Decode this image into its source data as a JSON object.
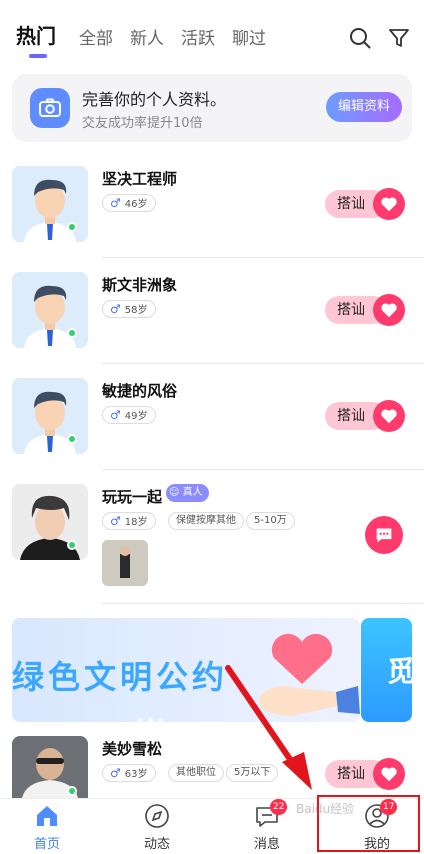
{
  "tabs": [
    {
      "label": "热门",
      "active": true
    },
    {
      "label": "全部"
    },
    {
      "label": "新人"
    },
    {
      "label": "活跃"
    },
    {
      "label": "聊过"
    }
  ],
  "top_icons": [
    "search-icon",
    "filter-icon"
  ],
  "profile_card": {
    "title": "完善你的个人资料。",
    "subtitle": "交友成功率提升10倍",
    "button": "编辑资料"
  },
  "users": [
    {
      "name": "坚决工程师",
      "age": "46岁",
      "action": "搭讪"
    },
    {
      "name": "斯文非洲象",
      "age": "58岁",
      "action": "搭讪"
    },
    {
      "name": "敏捷的风俗",
      "age": "49岁",
      "action": "搭讪"
    },
    {
      "name": "玩玩一起",
      "verified": "真人",
      "age": "18岁",
      "tags": [
        "保健按摩其他",
        "5-10万"
      ]
    },
    {
      "name": "美妙雪松",
      "age": "63岁",
      "tags": [
        "其他职位",
        "5万以下"
      ],
      "action": "搭讪"
    }
  ],
  "banner": {
    "text": "绿色文明公约",
    "next_text": "觅"
  },
  "bottom_nav": [
    {
      "label": "首页",
      "icon": "home-icon",
      "active": true
    },
    {
      "label": "动态",
      "icon": "compass-icon"
    },
    {
      "label": "消息",
      "icon": "message-icon",
      "badge": "22"
    },
    {
      "label": "我的",
      "icon": "profile-icon",
      "badge": "17"
    }
  ],
  "watermark": "Baidu经验",
  "colors": {
    "accent": "#6b66ff",
    "pink": "#ff3b6e",
    "online": "#2fd36b",
    "annotation": "#e2141c"
  }
}
